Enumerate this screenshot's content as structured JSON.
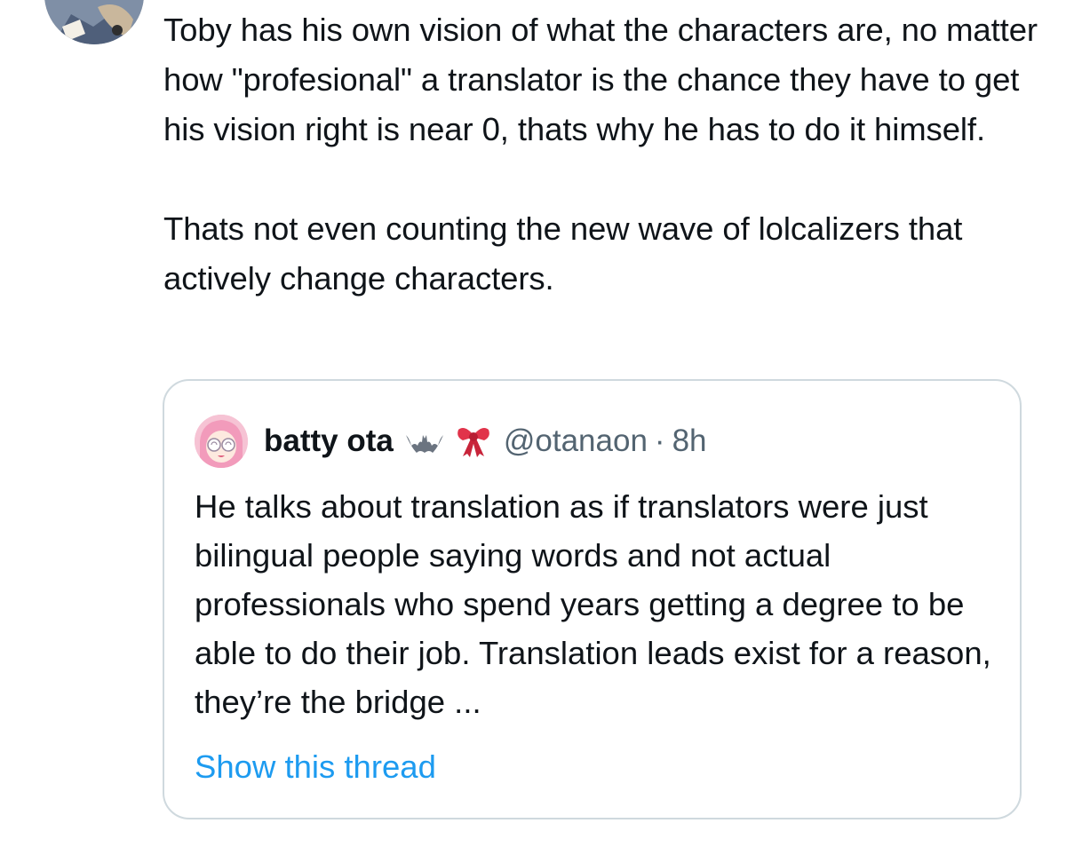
{
  "tweet": {
    "paragraphs": [
      "Toby has his own vision of what the characters are, no matter how \"profesional\" a translator is the chance they have to get his vision right is near 0, thats why he has to do it himself.",
      "Thats not even counting the new wave of lolcalizers that actively change characters."
    ]
  },
  "quote": {
    "display_name": "batty ota",
    "emojis": [
      "bat-icon",
      "ribbon-icon"
    ],
    "handle": "@otanaon",
    "separator": "·",
    "time": "8h",
    "text": "He talks about translation as if translators were just bilingual people saying words and not actual professionals who spend years getting a degree to be able to do their job. Translation leads exist for a reason, they’re the bridge ...",
    "show_thread_label": "Show this thread"
  },
  "colors": {
    "text": "#0f1419",
    "secondary": "#536471",
    "link": "#1d9bf0",
    "border": "#cfd9de"
  }
}
